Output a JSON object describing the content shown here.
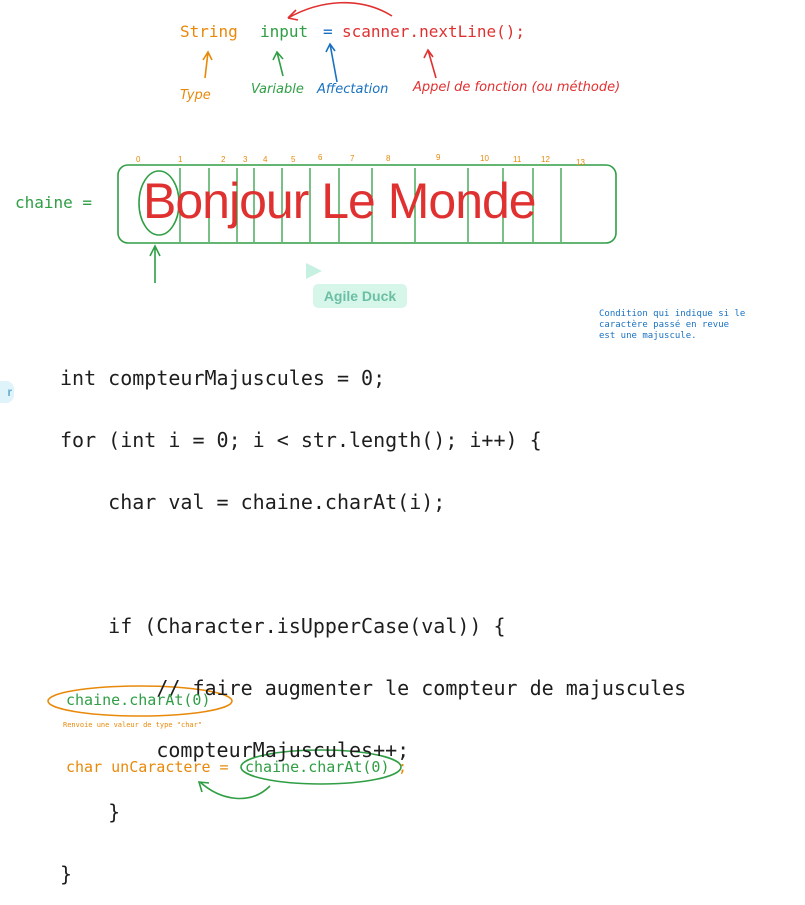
{
  "declaration": {
    "type_kw": "String",
    "var_name": "input",
    "assign": "=",
    "call": "scanner.nextLine();",
    "label_type": "Type",
    "label_variable": "Variable",
    "label_affectation": "Affectation",
    "label_appel": "Appel de fonction (ou méthode)"
  },
  "string_box": {
    "label": "chaine =",
    "text": "Bonjour Le Monde",
    "indices": [
      "0",
      "1",
      "2",
      "3",
      "4",
      "5",
      "6",
      "7",
      "8",
      "9",
      "10",
      "11",
      "12",
      "13"
    ]
  },
  "collaborator": {
    "name": "Agile Duck",
    "left_badge": "r"
  },
  "note": "Condition qui indique si le\ncaractère passé en revue\nest une majuscule.",
  "code": [
    "int compteurMajuscules = 0;",
    "for (int i = 0; i < str.length(); i++) {",
    "    char val = chaine.charAt(i);",
    "",
    "    if (Character.isUpperCase(val)) {",
    "        // faire augmenter le compteur de majuscules",
    "        compteurMajuscules++;",
    "    }",
    "}"
  ],
  "bottom": {
    "call_expr": "chaine.charAt(0)",
    "call_note": "Renvoie une valeur de type \"char\"",
    "decl_prefix": "char unCaractere = ",
    "decl_call": "chaine.charAt(0)",
    "decl_suffix": ";"
  },
  "colors": {
    "orange": "#e8890a",
    "green": "#2f9e44",
    "blue": "#1971c2",
    "red": "#e03131",
    "ink": "#1e1e1e"
  }
}
